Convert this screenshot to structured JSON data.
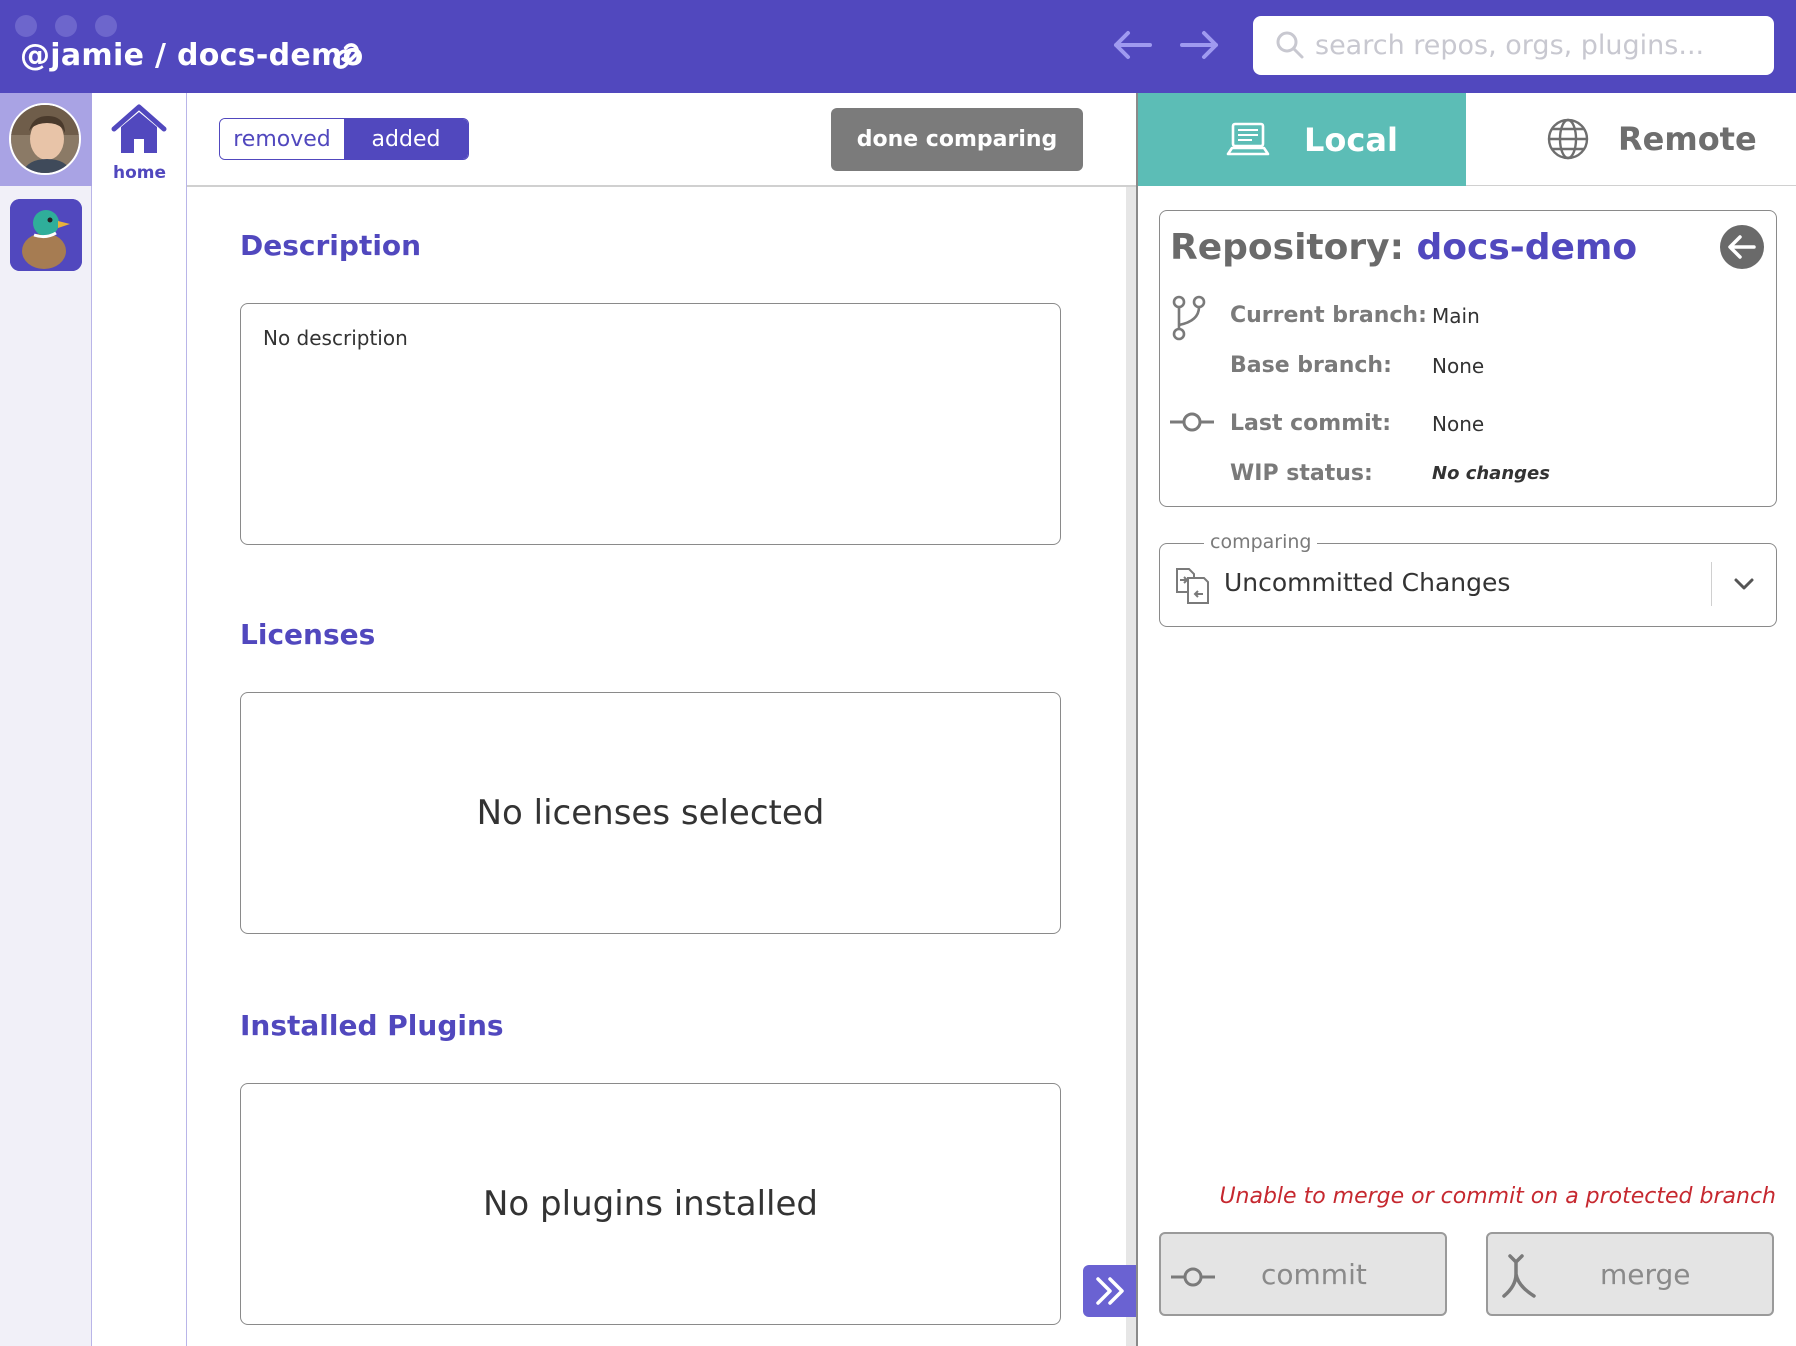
{
  "titlebar": {
    "repo_title": "@jamie / docs-demo",
    "search_placeholder": "search repos, orgs, plugins..."
  },
  "nav": {
    "home_label": "home"
  },
  "toolbar": {
    "toggle_removed": "removed",
    "toggle_added": "added",
    "done_label": "done comparing"
  },
  "main": {
    "description_title": "Description",
    "description_text": "No description",
    "licenses_title": "Licenses",
    "licenses_empty": "No licenses selected",
    "plugins_title": "Installed Plugins",
    "plugins_empty": "No plugins installed"
  },
  "panel": {
    "tab_local": "Local",
    "tab_remote": "Remote",
    "repo_label": "Repository:",
    "repo_name": "docs-demo",
    "current_branch_label": "Current branch:",
    "current_branch_value": "Main",
    "base_branch_label": "Base branch:",
    "base_branch_value": "None",
    "last_commit_label": "Last commit:",
    "last_commit_value": "None",
    "wip_label": "WIP status:",
    "wip_value": "No changes",
    "comparing_legend": "comparing",
    "comparing_value": "Uncommitted Changes",
    "warning": "Unable to merge or commit on a protected branch",
    "commit_label": "commit",
    "merge_label": "merge"
  },
  "colors": {
    "brand": "#5148be",
    "local_tab": "#5cbdb6",
    "warning": "#c6282f",
    "button_disabled": "#e4e4e4"
  },
  "icons": [
    "link-icon",
    "back-arrow-icon",
    "forward-arrow-icon",
    "search-icon",
    "home-icon",
    "laptop-icon",
    "globe-icon",
    "back-circle-icon",
    "branch-icon",
    "commit-icon",
    "compare-files-icon",
    "chevron-down-icon",
    "double-chevron-right-icon",
    "merge-icon"
  ]
}
